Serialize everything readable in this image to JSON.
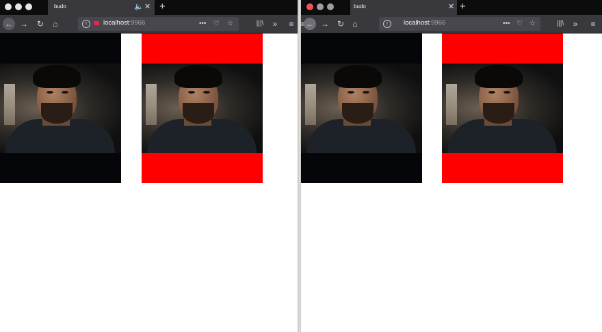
{
  "windows": [
    {
      "id": "left",
      "tab_title": "budo",
      "url_host": "localhost",
      "url_port": ":9966",
      "audio_icon": "speaker-icon",
      "videos": [
        {
          "label": "original-stream",
          "background": "#04060a"
        },
        {
          "label": "processed-stream",
          "background": "#ff0000"
        }
      ]
    },
    {
      "id": "right",
      "tab_title": "budo",
      "url_host": "localhost",
      "url_port": ":9966",
      "videos": [
        {
          "label": "original-stream",
          "background": "#04060a"
        },
        {
          "label": "processed-stream",
          "background": "#ff0000"
        }
      ]
    }
  ],
  "toolbar": {
    "page_actions": "•••",
    "overflow": "»"
  },
  "colors": {
    "tabbar": "#0c0c0d",
    "navbar": "#38383d",
    "red_letterbox": "#ff0000"
  }
}
